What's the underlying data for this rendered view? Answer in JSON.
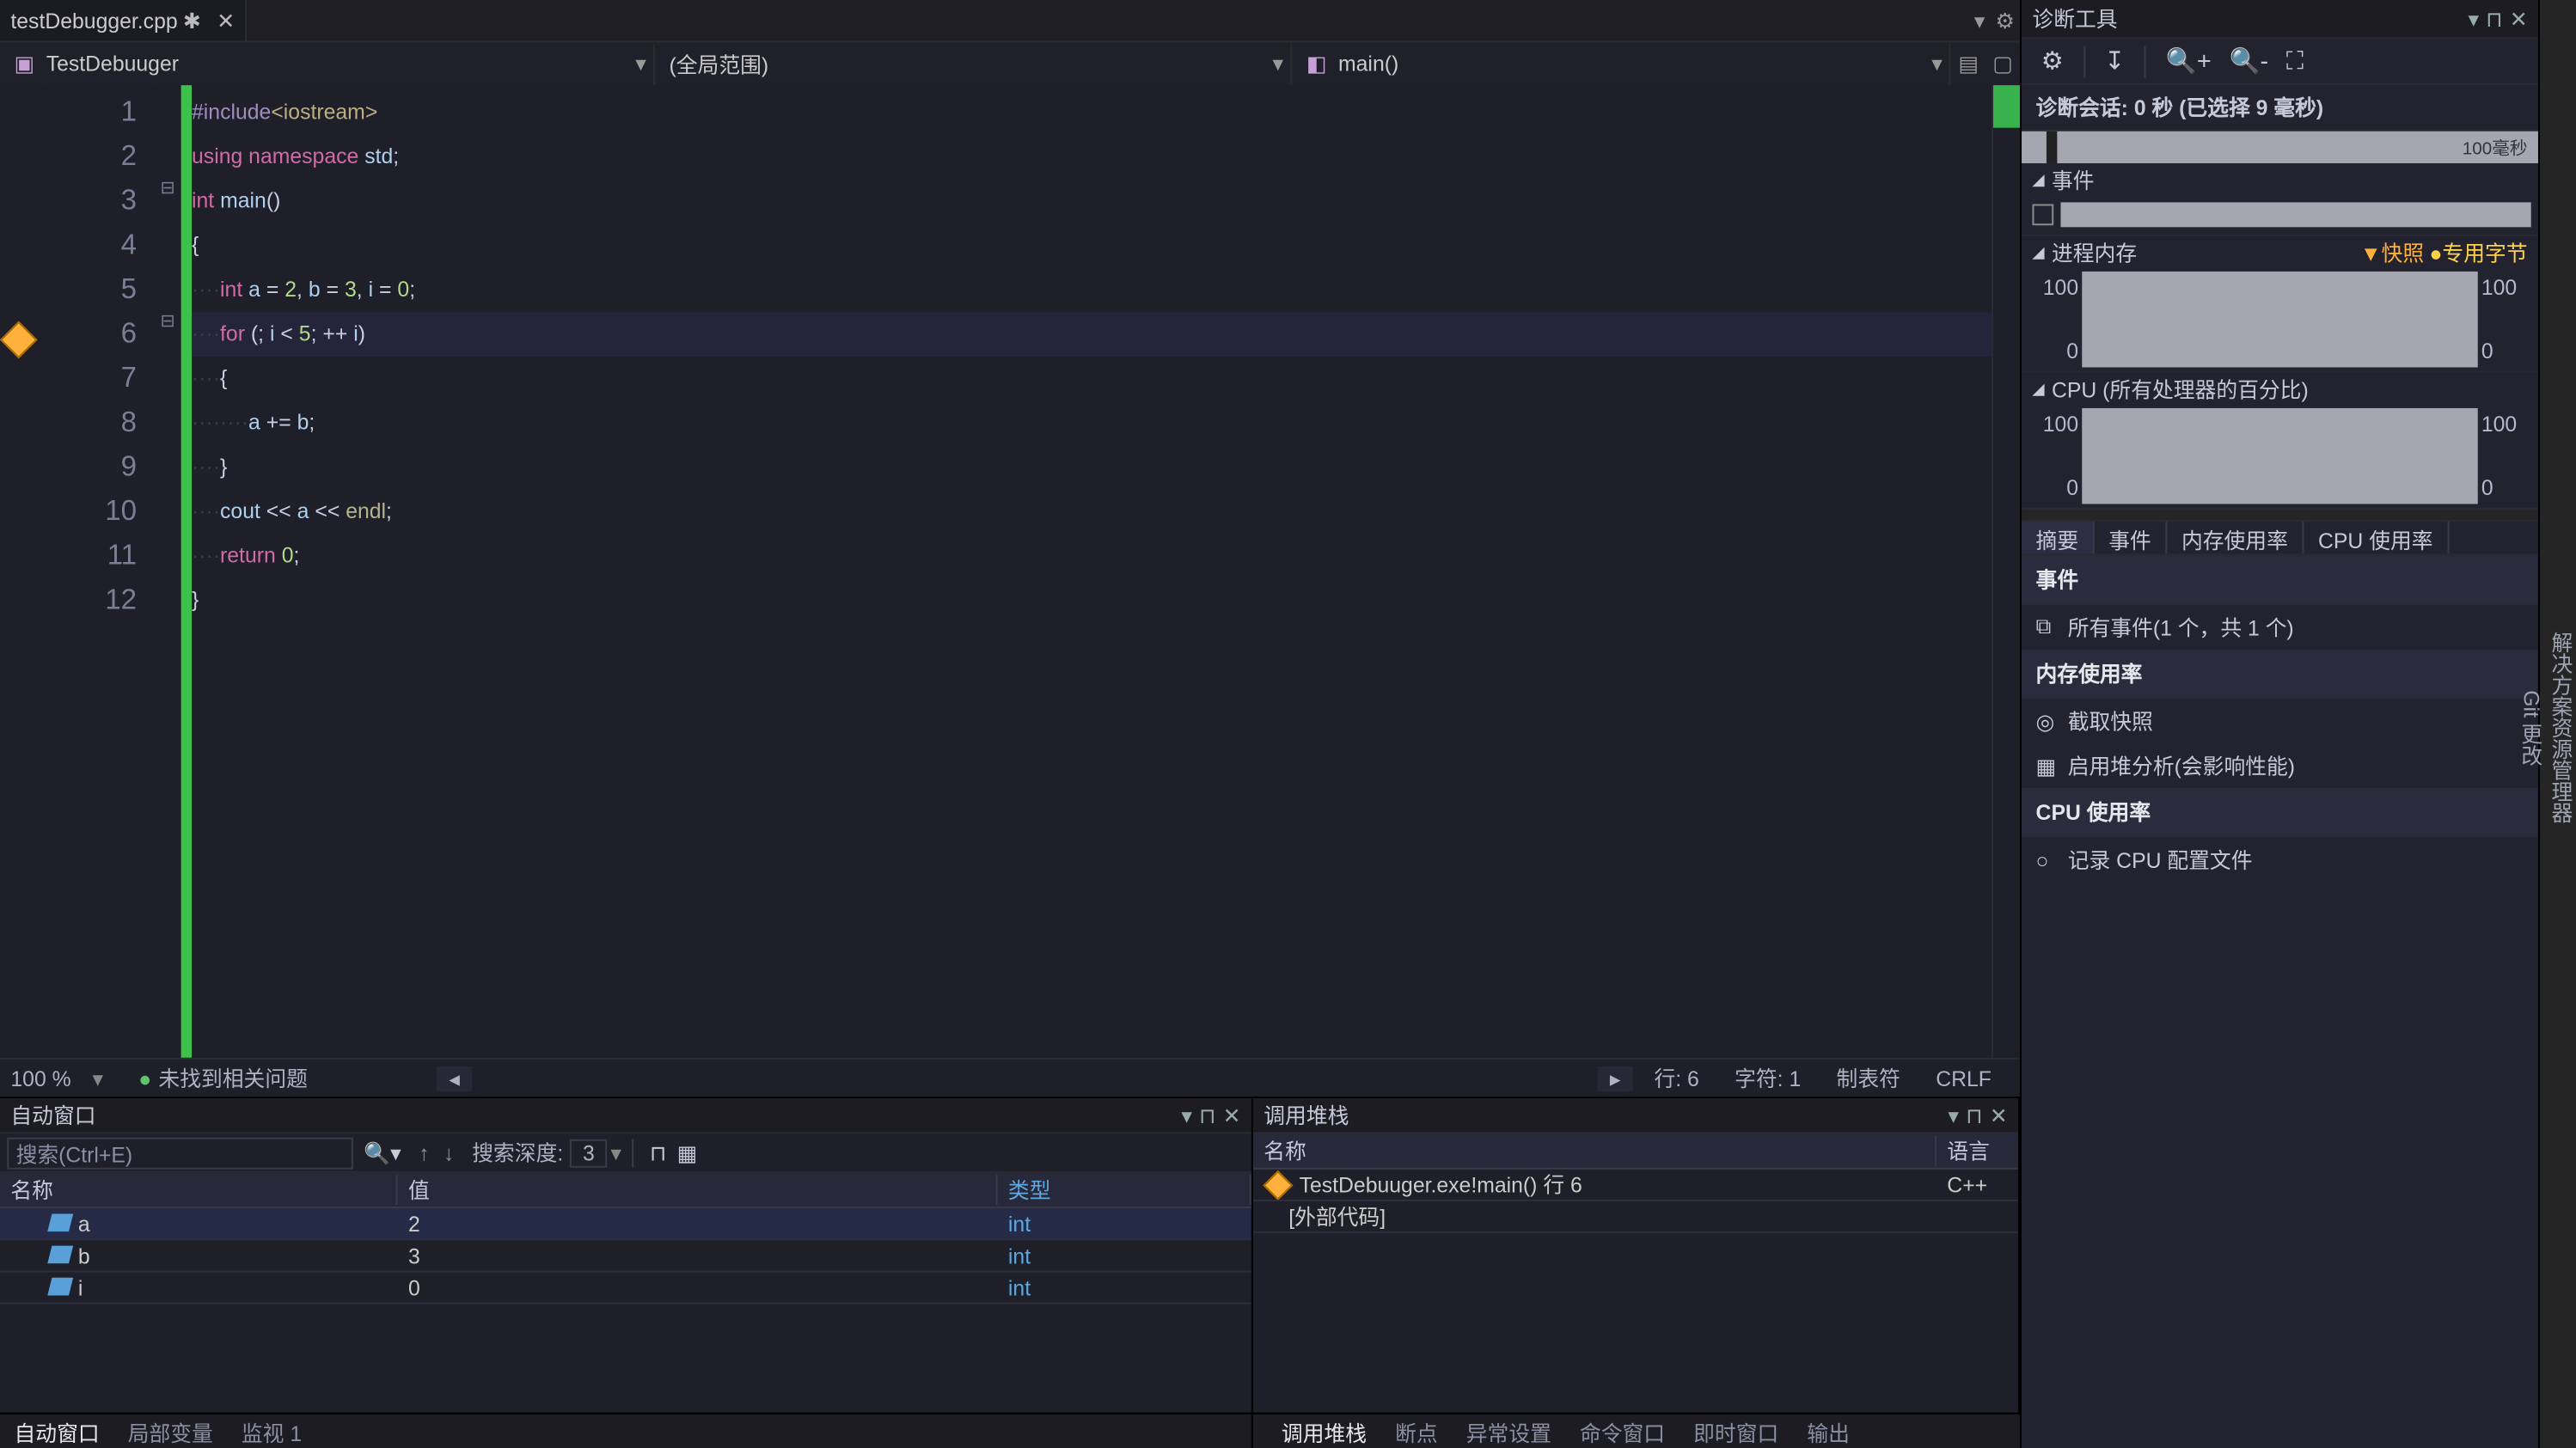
{
  "file_tab": {
    "name": "testDebugger.cpp",
    "dirty": "✱",
    "close_glyph": "✕"
  },
  "nav": {
    "cls": "TestDebuuger",
    "scope": "(全局范围)",
    "func": "main()"
  },
  "code_lines": 12,
  "current_exec_line": 6,
  "statusbar": {
    "zoom": "100 %",
    "issues": "未找到相关问题",
    "line": "行: 6",
    "char": "字符: 1",
    "tab": "制表符",
    "eol": "CRLF"
  },
  "autos": {
    "title": "自动窗口",
    "search_placeholder": "搜索(Ctrl+E)",
    "depth_label": "搜索深度:",
    "depth_value": "3",
    "cols": {
      "name": "名称",
      "value": "值",
      "type": "类型"
    },
    "rows": [
      {
        "name": "a",
        "value": "2",
        "type": "int"
      },
      {
        "name": "b",
        "value": "3",
        "type": "int"
      },
      {
        "name": "i",
        "value": "0",
        "type": "int"
      }
    ],
    "bottom_tabs": [
      "自动窗口",
      "局部变量",
      "监视 1"
    ]
  },
  "callstack": {
    "title": "调用堆栈",
    "cols": {
      "name": "名称",
      "lang": "语言"
    },
    "rows": [
      {
        "name": "TestDebuuger.exe!main() 行 6",
        "lang": "C++",
        "current": true
      },
      {
        "name": "[外部代码]",
        "lang": "",
        "current": false
      }
    ],
    "bottom_tabs": [
      "调用堆栈",
      "断点",
      "异常设置",
      "命令窗口",
      "即时窗口",
      "输出"
    ]
  },
  "diag": {
    "title": "诊断工具",
    "session": "诊断会话: 0 秒 (已选择 9 毫秒)",
    "timeline_label": "100毫秒",
    "events_title": "事件",
    "mem_title": "进程内存",
    "mem_legend_a": "▼快照",
    "mem_legend_b": "●专用字节",
    "cpu_title": "CPU (所有处理器的百分比)",
    "y_top": "100",
    "y_bot": "0",
    "tabs": [
      "摘要",
      "事件",
      "内存使用率",
      "CPU 使用率"
    ],
    "body": {
      "events_t": "事件",
      "events_item": "所有事件(1 个，共 1 个)",
      "mem_t": "内存使用率",
      "mem_i1": "截取快照",
      "mem_i2": "启用堆分析(会影响性能)",
      "cpu_t": "CPU 使用率",
      "cpu_i1": "记录 CPU 配置文件"
    }
  },
  "side_tabs": [
    "解决方案资源管理器",
    "Git 更改"
  ]
}
